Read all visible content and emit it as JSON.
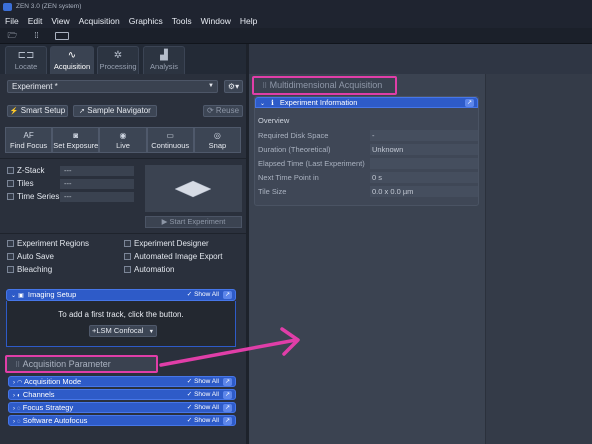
{
  "window": {
    "title": "ZEN 3.0 (ZEN system)"
  },
  "menu": [
    "File",
    "Edit",
    "View",
    "Acquisition",
    "Graphics",
    "Tools",
    "Window",
    "Help"
  ],
  "toolbar": {
    "icons": [
      "open-folder-icon",
      "grid-icon",
      "layout-icon"
    ]
  },
  "tabs": [
    {
      "label": "Locate",
      "icon": "locate-icon",
      "active": false
    },
    {
      "label": "Acquisition",
      "icon": "acquisition-icon",
      "active": true
    },
    {
      "label": "Processing",
      "icon": "processing-icon",
      "active": false
    },
    {
      "label": "Analysis",
      "icon": "analysis-icon",
      "active": false
    }
  ],
  "experiment": {
    "selected": "Experiment *",
    "settings_icon": "gear-icon"
  },
  "buttons": {
    "smart_setup": "Smart Setup",
    "sample_navigator": "Sample Navigator",
    "reuse": "Reuse",
    "find_focus": "Find Focus",
    "find_focus_icon_text": "AF",
    "set_exposure": "Set Exposure",
    "live": "Live",
    "continuous": "Continuous",
    "snap": "Snap",
    "start_experiment": "Start Experiment"
  },
  "dimensions": [
    {
      "label": "Z-Stack",
      "value": "---"
    },
    {
      "label": "Tiles",
      "value": "---"
    },
    {
      "label": "Time Series",
      "value": "---"
    }
  ],
  "options_left": [
    "Experiment Regions",
    "Auto Save",
    "Bleaching"
  ],
  "options_right": [
    "Experiment Designer",
    "Automated Image Export",
    "Automation"
  ],
  "imaging_setup": {
    "title": "Imaging Setup",
    "show_all": "Show All",
    "message": "To add a first track, click the button.",
    "add_button": "+LSM Confocal"
  },
  "acquisition_parameter": {
    "title": "Acquisition Parameter",
    "items": [
      {
        "label": "Acquisition Mode",
        "show_all": "Show All"
      },
      {
        "label": "Channels",
        "show_all": "Show All"
      },
      {
        "label": "Focus Strategy",
        "show_all": "Show All"
      },
      {
        "label": "Software Autofocus",
        "show_all": "Show All"
      }
    ]
  },
  "multidimensional": {
    "title": "Multidimensional Acquisition",
    "panel_title": "Experiment Information",
    "overview": "Overview",
    "rows": [
      {
        "label": "Required Disk Space",
        "value": "-"
      },
      {
        "label": "Duration (Theoretical)",
        "value": "Unknown"
      },
      {
        "label": "Elapsed Time (Last Experiment)",
        "value": ""
      },
      {
        "label": "Next Time Point in",
        "value": "0 s"
      },
      {
        "label": "Tile Size",
        "value": "0.0 x 0.0 µm"
      }
    ]
  },
  "colors": {
    "accent": "#2e5bc8",
    "highlight": "#e03ea8",
    "arrow": "#e03ea8"
  }
}
